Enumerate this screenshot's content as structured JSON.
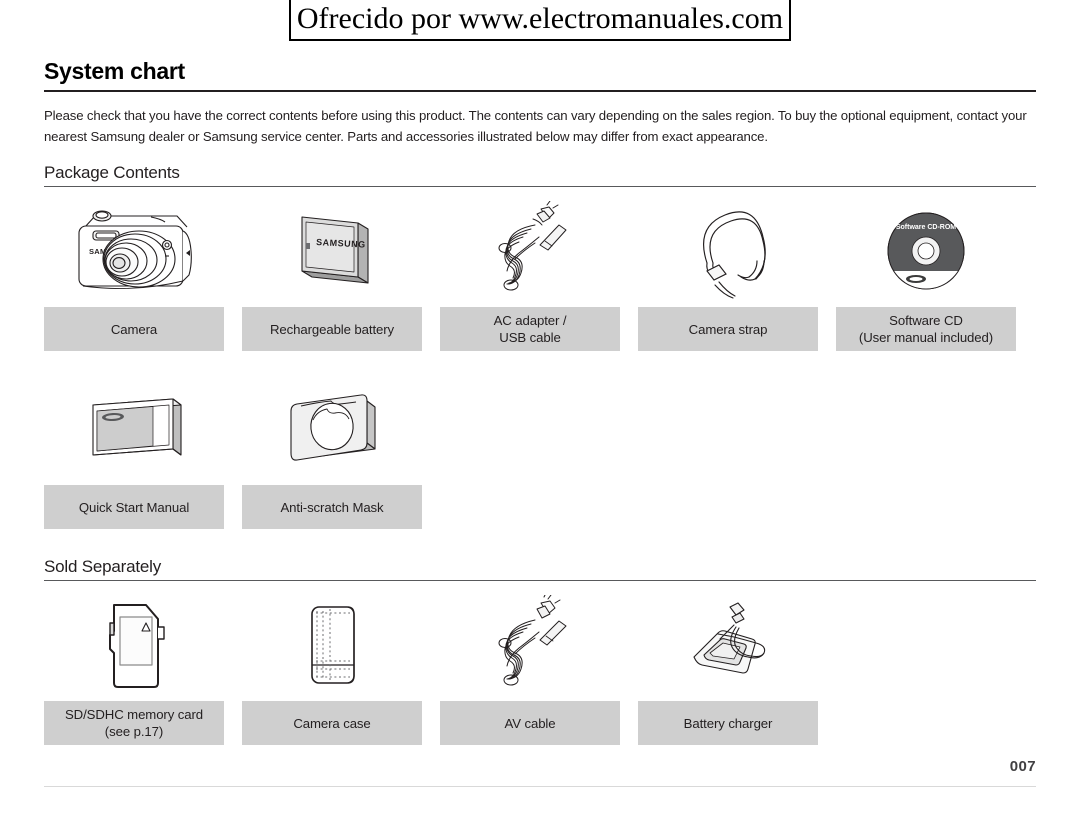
{
  "watermark": {
    "text": "Ofrecido por www.electromanuales.com"
  },
  "chapter": {
    "title": "System chart",
    "intro": "Please check that you have the correct contents before using this product. The contents can vary depending on the sales region. To buy the optional equipment, contact your nearest Samsung dealer or Samsung service center. Parts and accessories illustrated below may differ from exact appearance."
  },
  "sections": [
    {
      "heading": "Package Contents",
      "rows": [
        [
          {
            "icon": "camera-icon",
            "label_line1": "Camera",
            "label_line2": ""
          },
          {
            "icon": "battery-icon",
            "label_line1": "Rechargeable battery",
            "label_line2": ""
          },
          {
            "icon": "ac-adapter-usb-cable-icon",
            "label_line1": "AC adapter /",
            "label_line2": "USB cable"
          },
          {
            "icon": "camera-strap-icon",
            "label_line1": "Camera strap",
            "label_line2": ""
          },
          {
            "icon": "software-cd-icon",
            "label_line1": "Software CD",
            "label_line2": "(User manual included)"
          }
        ],
        [
          {
            "icon": "quick-start-manual-icon",
            "label_line1": "Quick Start Manual",
            "label_line2": ""
          },
          {
            "icon": "anti-scratch-mask-icon",
            "label_line1": "Anti-scratch Mask",
            "label_line2": ""
          }
        ]
      ]
    },
    {
      "heading": "Sold Separately",
      "rows": [
        [
          {
            "icon": "sd-card-icon",
            "label_line1": "SD/SDHC memory card",
            "label_line2": "(see p.17)"
          },
          {
            "icon": "camera-case-icon",
            "label_line1": "Camera case",
            "label_line2": ""
          },
          {
            "icon": "av-cable-icon",
            "label_line1": "AV cable",
            "label_line2": ""
          },
          {
            "icon": "battery-charger-icon",
            "label_line1": "Battery charger",
            "label_line2": ""
          }
        ]
      ]
    }
  ],
  "artwork_text": {
    "camera_brand": "SAMSUNG",
    "battery_brand": "SAMSUNG",
    "cd_label": "Software CD-ROM"
  },
  "footer": {
    "page_number": "007"
  },
  "colors": {
    "caption_background": "#cfcfcf",
    "text": "#231f20",
    "rule": "#58595b",
    "page_number": "#414042",
    "cd_disc": "#58595b"
  }
}
